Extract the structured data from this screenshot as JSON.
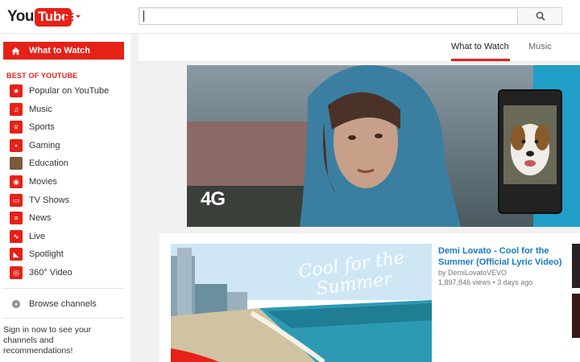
{
  "header": {
    "logo_you": "You",
    "logo_tube": "Tube",
    "search_value": "",
    "brand_color": "#e62117"
  },
  "sidebar": {
    "active_item": "What to Watch",
    "section_title": "BEST OF YOUTUBE",
    "items": [
      {
        "label": "Popular on YouTube",
        "icon": "popular-icon",
        "color": "#e62117"
      },
      {
        "label": "Music",
        "icon": "headphones-icon",
        "color": "#e62117"
      },
      {
        "label": "Sports",
        "icon": "trophy-icon",
        "color": "#e62117"
      },
      {
        "label": "Gaming",
        "icon": "gamepad-icon",
        "color": "#e62117"
      },
      {
        "label": "Education",
        "icon": "education-thumb-icon",
        "color": "#7a5a3a"
      },
      {
        "label": "Movies",
        "icon": "film-reel-icon",
        "color": "#e62117"
      },
      {
        "label": "TV Shows",
        "icon": "tv-icon",
        "color": "#e62117"
      },
      {
        "label": "News",
        "icon": "newspaper-icon",
        "color": "#e62117"
      },
      {
        "label": "Live",
        "icon": "live-icon",
        "color": "#e62117"
      },
      {
        "label": "Spotlight",
        "icon": "spotlight-icon",
        "color": "#e62117"
      },
      {
        "label": "360° Video",
        "icon": "360-icon",
        "color": "#e62117"
      }
    ],
    "browse_channels": "Browse channels",
    "signin_text": "Sign in now to see your channels and recommendations!"
  },
  "tabs": [
    {
      "label": "What to Watch",
      "active": true
    },
    {
      "label": "Music",
      "active": false
    }
  ],
  "ad": {
    "badge": "4G"
  },
  "featured": {
    "title": "Demi Lovato - Cool for the Summer (Official Lyric Video)",
    "by_prefix": "by ",
    "channel": "DemiLovatoVEVO",
    "views": "1,897,846 views",
    "age": "3 days ago",
    "meta_separator": " • ",
    "thumb_text": "Cool for the Summer"
  }
}
